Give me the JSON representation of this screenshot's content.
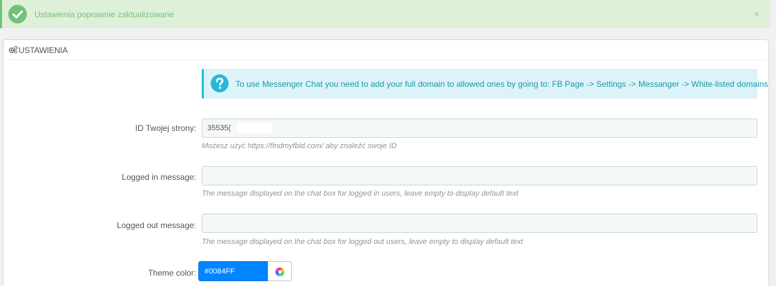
{
  "alert": {
    "message": "Ustawienia poprawnie zaktualizowane",
    "close": "×",
    "icon": "check-circle-icon",
    "color": "#72c279"
  },
  "panel": {
    "title": "USTAWIENIA",
    "icon": "cogs-icon"
  },
  "info": {
    "text": "To use Messenger Chat you need to add your full domain to allowed ones by going to: FB Page -> Settings -> Messanger -> White-listed domains",
    "icon": "question-circle-icon",
    "color": "#25b9d7"
  },
  "fields": {
    "page_id": {
      "label": "ID Twojej strony:",
      "value": "35535(",
      "help": "Możesz użyć https://findmyfbid.com/ aby znaleźć swoje ID"
    },
    "logged_in": {
      "label": "Logged in message:",
      "value": "",
      "help": "The message displayed on the chat box for logged in users, leave empty to display default text"
    },
    "logged_out": {
      "label": "Logged out message:",
      "value": "",
      "help": "The message displayed on the chat box for logged out users, leave empty to display default text"
    },
    "theme_color": {
      "label": "Theme color:",
      "value": "#0084FF",
      "swatch": "#0084ff",
      "button_icon": "color-wheel-icon"
    }
  }
}
